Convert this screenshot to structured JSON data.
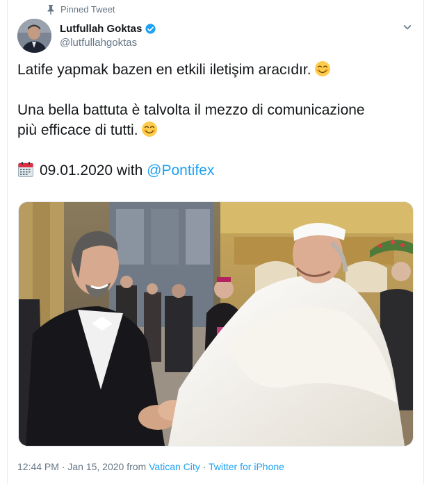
{
  "tweet": {
    "pinned_label": "Pinned Tweet",
    "author_name": "Lutfullah Goktas",
    "author_handle": "@lutfullahgoktas",
    "line1": "Latife yapmak bazen en etkili iletişim aracıdır.",
    "line2": "Una bella battuta è talvolta il mezzo di comunicazione",
    "line3": "più efficace di tutti.",
    "date_text": "09.01.2020 with",
    "mention": "@Pontifex",
    "timestamp": "12:44 PM · Jan 15, 2020 from",
    "location": "Vatican City",
    "separator": "·",
    "source": "Twitter for iPhone"
  },
  "icons": {
    "pin": "pin-icon",
    "verified": "verified-badge-icon",
    "caret": "chevron-down-icon",
    "emoji": "smiling-face-with-smiling-eyes-emoji",
    "calendar": "calendar-icon"
  },
  "colors": {
    "link": "#1da1f2",
    "secondary_text": "#657786",
    "primary_text": "#14171a"
  }
}
